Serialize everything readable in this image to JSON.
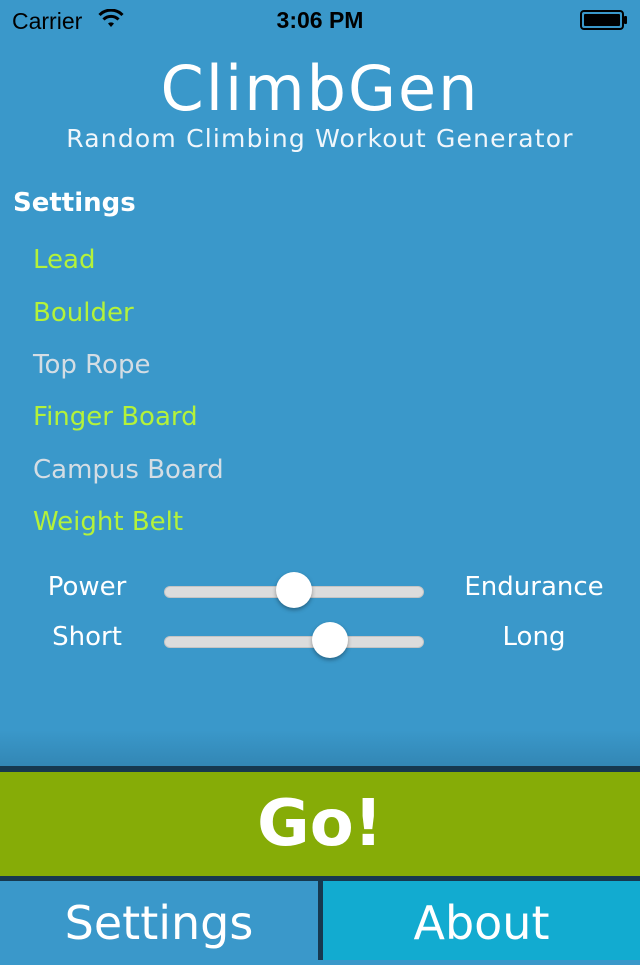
{
  "status_bar": {
    "carrier": "Carrier",
    "time": "3:06 PM",
    "icons": [
      "wifi-icon",
      "battery-icon"
    ]
  },
  "header": {
    "title": "ClimbGen",
    "subtitle": "Random Climbing Workout Generator"
  },
  "settings": {
    "heading": "Settings",
    "options": [
      {
        "label": "Lead",
        "enabled": true
      },
      {
        "label": "Boulder",
        "enabled": true
      },
      {
        "label": "Top Rope",
        "enabled": false
      },
      {
        "label": "Finger Board",
        "enabled": true
      },
      {
        "label": "Campus Board",
        "enabled": false
      },
      {
        "label": "Weight Belt",
        "enabled": true
      }
    ],
    "enabled_color": "#b4f23a",
    "disabled_color": "#d4dde4"
  },
  "sliders": [
    {
      "min_label": "Power",
      "max_label": "Endurance",
      "value": 0.5
    },
    {
      "min_label": "Short",
      "max_label": "Long",
      "value": 0.64
    }
  ],
  "go_button": {
    "label": "Go!",
    "color": "#86ac07"
  },
  "tabs": [
    {
      "label": "Settings",
      "color": "#3a98ca"
    },
    {
      "label": "About",
      "color": "#12abd0"
    }
  ],
  "colors": {
    "background": "#3a98ca",
    "dark_bar": "#16384f"
  }
}
